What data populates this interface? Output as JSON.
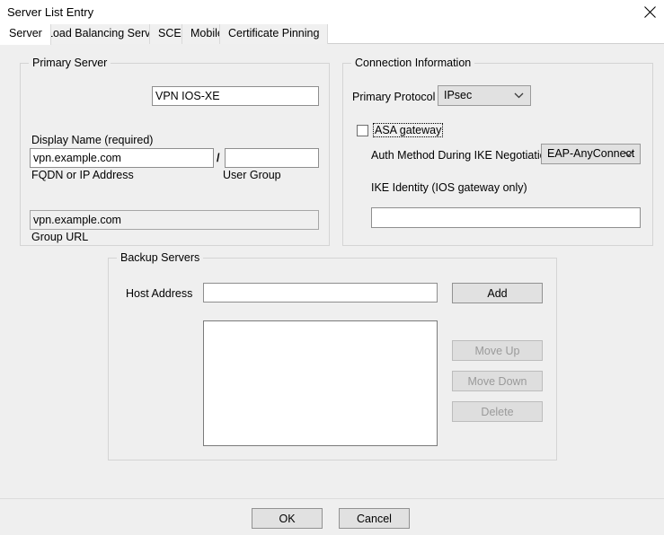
{
  "window": {
    "title": "Server List Entry",
    "close_icon": "close-icon"
  },
  "tabs": [
    {
      "label": "Server",
      "active": true
    },
    {
      "label": "Load Balancing Servers",
      "active": false
    },
    {
      "label": "SCEP",
      "active": false
    },
    {
      "label": "Mobile",
      "active": false
    },
    {
      "label": "Certificate Pinning",
      "active": false
    }
  ],
  "primary_server": {
    "legend": "Primary Server",
    "display_name_label": "Display Name (required)",
    "display_name_value": "VPN IOS-XE",
    "fqdn_label": "FQDN or IP Address",
    "fqdn_value": "vpn.example.com",
    "separator": "/",
    "user_group_label": "User Group",
    "user_group_value": "",
    "group_url_label": "Group URL",
    "group_url_value": "vpn.example.com"
  },
  "connection_information": {
    "legend": "Connection Information",
    "primary_protocol_label": "Primary Protocol",
    "primary_protocol_value": "IPsec",
    "asa_gateway_label": "ASA gateway",
    "asa_gateway_checked": false,
    "auth_method_label": "Auth Method During IKE Negotiation",
    "auth_method_value": "EAP-AnyConnect",
    "ike_identity_label": "IKE Identity (IOS gateway only)",
    "ike_identity_value": ""
  },
  "backup_servers": {
    "legend": "Backup Servers",
    "host_address_label": "Host Address",
    "host_address_value": "",
    "add_label": "Add",
    "move_up_label": "Move Up",
    "move_down_label": "Move Down",
    "delete_label": "Delete",
    "list_items": []
  },
  "footer": {
    "ok_label": "OK",
    "cancel_label": "Cancel"
  },
  "colors": {
    "dialog_background": "#efefef",
    "titlebar_background": "#ffffff",
    "field_background": "#ffffff",
    "disabled_field_background": "#efefef",
    "button_background": "#e1e1e1",
    "disabled_text": "#9a9a9a",
    "border": "#d4d4d4"
  }
}
